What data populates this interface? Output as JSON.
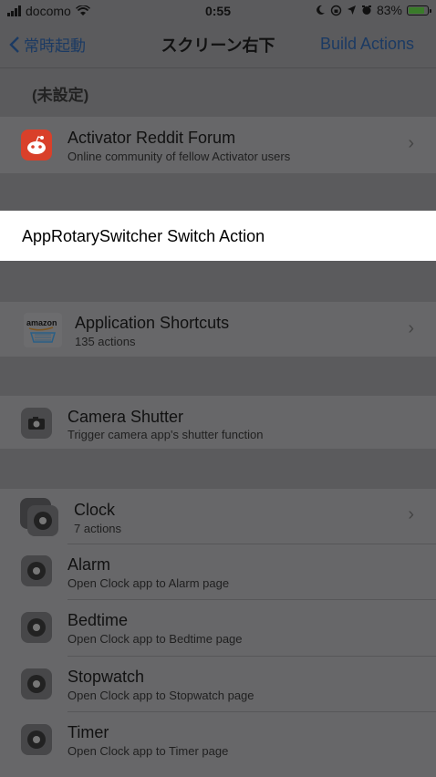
{
  "status": {
    "carrier": "docomo",
    "time": "0:55",
    "battery_percent": "83%",
    "battery_level": 0.83
  },
  "nav": {
    "back_label": "常時起動",
    "title": "スクリーン右下",
    "action_label": "Build Actions"
  },
  "section_header": "(未設定)",
  "items": {
    "reddit": {
      "title": "Activator Reddit Forum",
      "subtitle": "Online community of fellow Activator users"
    },
    "highlighted": {
      "title": "AppRotarySwitcher Switch Action"
    },
    "app_shortcuts": {
      "title": "Application Shortcuts",
      "subtitle": "135 actions",
      "icon_text": "amazon"
    },
    "camera": {
      "title": "Camera Shutter",
      "subtitle": "Trigger camera app's shutter function"
    },
    "clock": {
      "title": "Clock",
      "subtitle": "7 actions"
    },
    "alarm": {
      "title": "Alarm",
      "subtitle": "Open Clock app to Alarm page"
    },
    "bedtime": {
      "title": "Bedtime",
      "subtitle": "Open Clock app to Bedtime page"
    },
    "stopwatch": {
      "title": "Stopwatch",
      "subtitle": "Open Clock app to Stopwatch page"
    },
    "timer": {
      "title": "Timer",
      "subtitle": "Open Clock app to Timer page"
    }
  },
  "icons": {
    "back": "chevron-left-icon",
    "chevron": "chevron-right-icon",
    "wifi": "wifi-icon",
    "moon": "moon-icon",
    "location": "location-icon",
    "alarm": "alarm-icon"
  },
  "colors": {
    "accent": "#1b3a63",
    "reddit": "#e4472a",
    "highlight": "#ffffff"
  }
}
